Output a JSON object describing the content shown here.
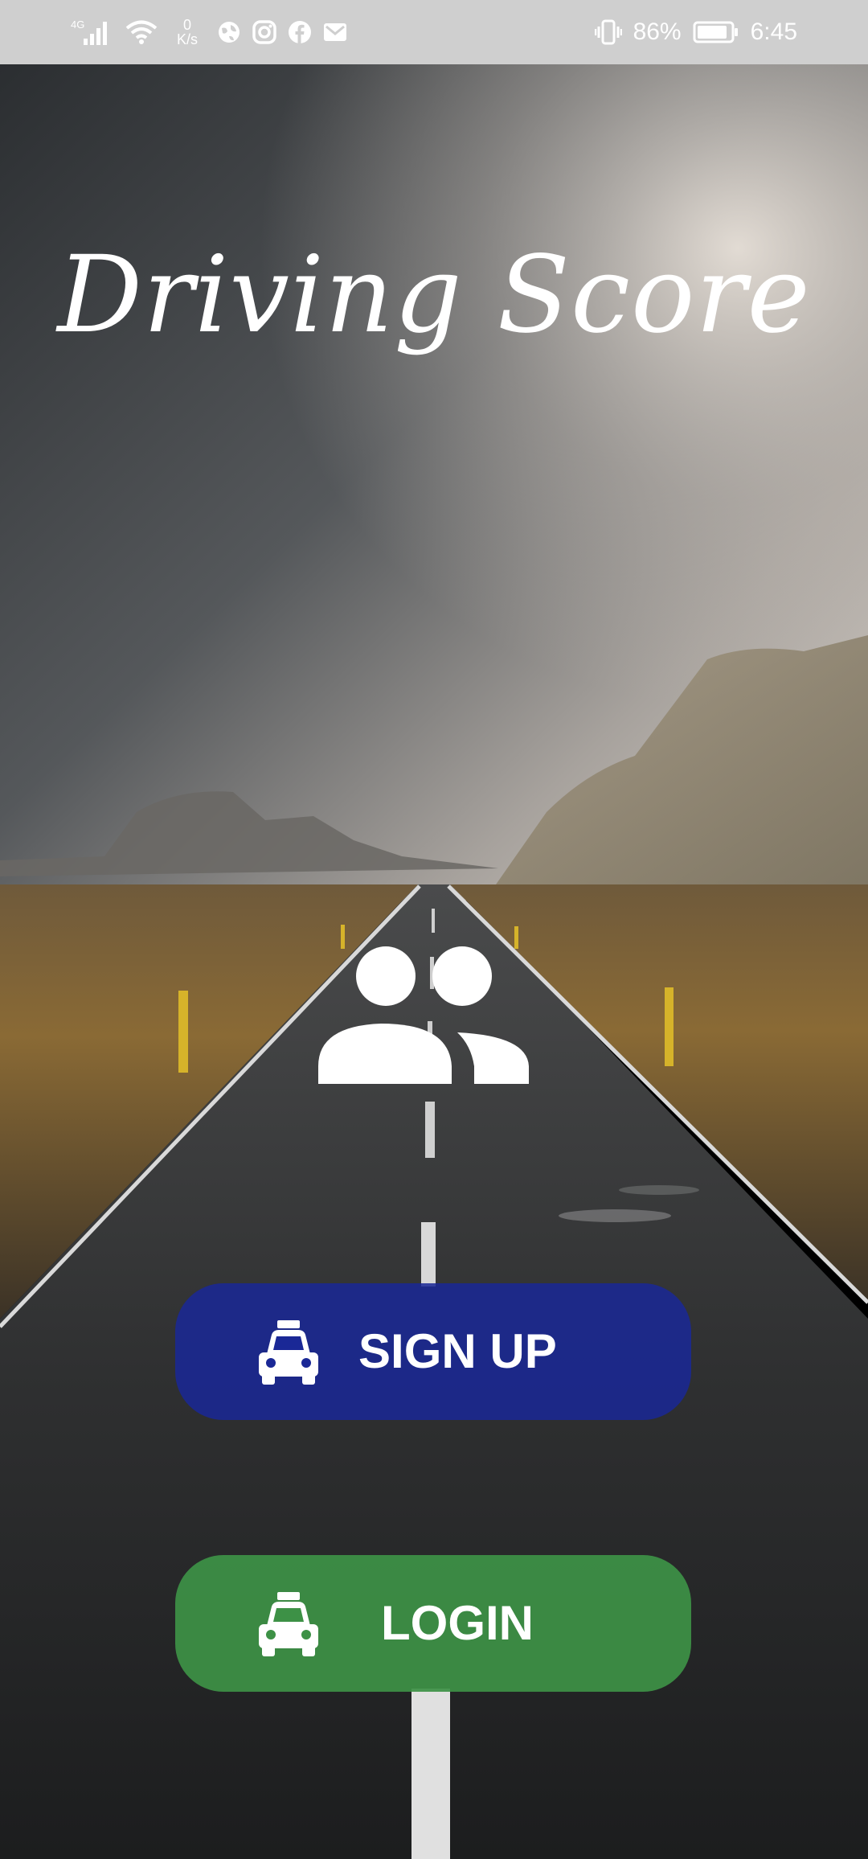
{
  "status_bar": {
    "network_type": "4G",
    "net_speed_value": "0",
    "net_speed_unit": "K/s",
    "battery_percent": "86%",
    "time": "6:45",
    "left_icons": [
      "signal-icon",
      "wifi-icon",
      "globe-icon",
      "instagram-icon",
      "facebook-icon",
      "mail-icon"
    ],
    "right_icons": [
      "vibrate-icon",
      "battery-icon"
    ]
  },
  "app": {
    "title": "Driving Score"
  },
  "hero_icon": "users-icon",
  "buttons": {
    "signup": {
      "label": "SIGN UP",
      "icon": "taxi-icon",
      "color": "#1a2896"
    },
    "login": {
      "label": "LOGIN",
      "icon": "taxi-icon",
      "color": "#3d9146"
    }
  },
  "colors": {
    "status_bar_bg": "#cfcfcf",
    "title_text": "#ffffff"
  }
}
